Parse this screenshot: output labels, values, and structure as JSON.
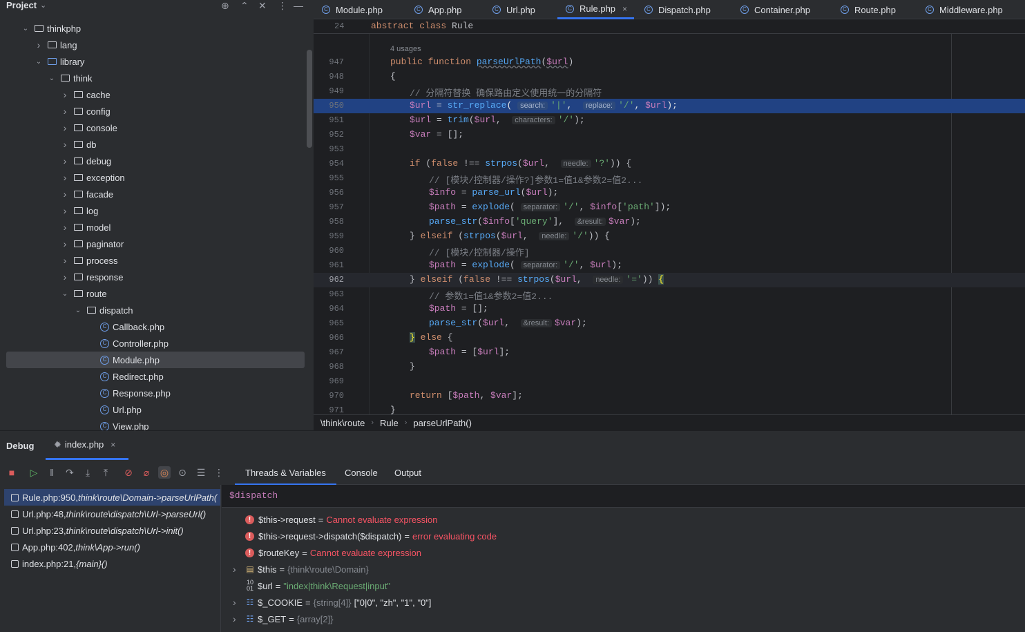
{
  "project": {
    "title": "Project",
    "tree": [
      {
        "label": "thinkphp",
        "indent": 0,
        "arrow": "open",
        "icon": "folder"
      },
      {
        "label": "lang",
        "indent": 1,
        "arrow": "closed",
        "icon": "folder"
      },
      {
        "label": "library",
        "indent": 1,
        "arrow": "open",
        "icon": "folder-blue"
      },
      {
        "label": "think",
        "indent": 2,
        "arrow": "open",
        "icon": "folder"
      },
      {
        "label": "cache",
        "indent": 3,
        "arrow": "closed",
        "icon": "folder"
      },
      {
        "label": "config",
        "indent": 3,
        "arrow": "closed",
        "icon": "folder"
      },
      {
        "label": "console",
        "indent": 3,
        "arrow": "closed",
        "icon": "folder"
      },
      {
        "label": "db",
        "indent": 3,
        "arrow": "closed",
        "icon": "folder"
      },
      {
        "label": "debug",
        "indent": 3,
        "arrow": "closed",
        "icon": "folder"
      },
      {
        "label": "exception",
        "indent": 3,
        "arrow": "closed",
        "icon": "folder"
      },
      {
        "label": "facade",
        "indent": 3,
        "arrow": "closed",
        "icon": "folder"
      },
      {
        "label": "log",
        "indent": 3,
        "arrow": "closed",
        "icon": "folder"
      },
      {
        "label": "model",
        "indent": 3,
        "arrow": "closed",
        "icon": "folder"
      },
      {
        "label": "paginator",
        "indent": 3,
        "arrow": "closed",
        "icon": "folder"
      },
      {
        "label": "process",
        "indent": 3,
        "arrow": "closed",
        "icon": "folder"
      },
      {
        "label": "response",
        "indent": 3,
        "arrow": "closed",
        "icon": "folder"
      },
      {
        "label": "route",
        "indent": 3,
        "arrow": "open",
        "icon": "folder"
      },
      {
        "label": "dispatch",
        "indent": 4,
        "arrow": "open",
        "icon": "folder"
      },
      {
        "label": "Callback.php",
        "indent": 5,
        "arrow": "none",
        "icon": "php"
      },
      {
        "label": "Controller.php",
        "indent": 5,
        "arrow": "none",
        "icon": "php"
      },
      {
        "label": "Module.php",
        "indent": 5,
        "arrow": "none",
        "icon": "php",
        "selected": true
      },
      {
        "label": "Redirect.php",
        "indent": 5,
        "arrow": "none",
        "icon": "php"
      },
      {
        "label": "Response.php",
        "indent": 5,
        "arrow": "none",
        "icon": "php"
      },
      {
        "label": "Url.php",
        "indent": 5,
        "arrow": "none",
        "icon": "php"
      },
      {
        "label": "View.php",
        "indent": 5,
        "arrow": "none",
        "icon": "php"
      }
    ]
  },
  "tabs": [
    {
      "label": "Module.php"
    },
    {
      "label": "App.php"
    },
    {
      "label": "Url.php"
    },
    {
      "label": "Rule.php",
      "active": true,
      "close": "×"
    },
    {
      "label": "Dispatch.php"
    },
    {
      "label": "Container.php"
    },
    {
      "label": "Route.php"
    },
    {
      "label": "Middleware.php"
    }
  ],
  "editor": {
    "sticky_line": "24",
    "sticky_kw": "abstract class",
    "sticky_name": "Rule",
    "usages": "4 usages",
    "breadcrumb": [
      "\\think\\route",
      "Rule",
      "parseUrlPath()"
    ],
    "code": {
      "l947": "947",
      "l948": "948",
      "l949": "949",
      "l950": "950",
      "l951": "951",
      "l952": "952",
      "l953": "953",
      "l954": "954",
      "l955": "955",
      "l956": "956",
      "l957": "957",
      "l958": "958",
      "l959": "959",
      "l960": "960",
      "l961": "961",
      "l962": "962",
      "l963": "963",
      "l964": "964",
      "l965": "965",
      "l966": "966",
      "l967": "967",
      "l968": "968",
      "l969": "969",
      "l970": "970",
      "l971": "971",
      "c949": "// 分隔符替换 确保路由定义使用统一的分隔符",
      "c955": "// [模块/控制器/操作?]参数1=值1&参数2=值2...",
      "c960": "// [模块/控制器/操作]",
      "c963": "// 参数1=值1&参数2=值2..."
    }
  },
  "debug": {
    "title": "Debug",
    "session_tab": "index.php",
    "session_close": "×",
    "subtabs": [
      "Threads & Variables",
      "Console",
      "Output"
    ],
    "frames": [
      {
        "loc": "Rule.php:950,",
        "fn": "think\\route\\Domain->parseUrlPath(",
        "selected": true
      },
      {
        "loc": "Url.php:48,",
        "fn": "think\\route\\dispatch\\Url->parseUrl()"
      },
      {
        "loc": "Url.php:23,",
        "fn": "think\\route\\dispatch\\Url->init()"
      },
      {
        "loc": "App.php:402,",
        "fn": "think\\App->run()"
      },
      {
        "loc": "index.php:21,",
        "fn": "{main}()"
      }
    ],
    "eval_expr": "$dispatch",
    "variables": [
      {
        "icon": "error",
        "name": "$this->request",
        "kind": "err",
        "value": "Cannot evaluate expression"
      },
      {
        "icon": "error",
        "name": "$this->request->dispatch($dispatch)",
        "kind": "err",
        "value": "error evaluating code"
      },
      {
        "icon": "error",
        "name": "$routeKey",
        "kind": "err",
        "value": "Cannot evaluate expression"
      },
      {
        "icon": "object",
        "name": "$this",
        "kind": "type",
        "value": "{think\\route\\Domain}",
        "expandable": true
      },
      {
        "icon": "string",
        "name": "$url",
        "kind": "str",
        "value": "\"index|think\\Request|input\""
      },
      {
        "icon": "array",
        "name": "$_COOKIE",
        "kind": "type",
        "value": "{string[4]}",
        "extra": "[\"0|0\", \"zh\", \"1\", \"0\"]",
        "expandable": true
      },
      {
        "icon": "array",
        "name": "$_GET",
        "kind": "type",
        "value": "{array[2]}",
        "expandable": true
      }
    ]
  }
}
